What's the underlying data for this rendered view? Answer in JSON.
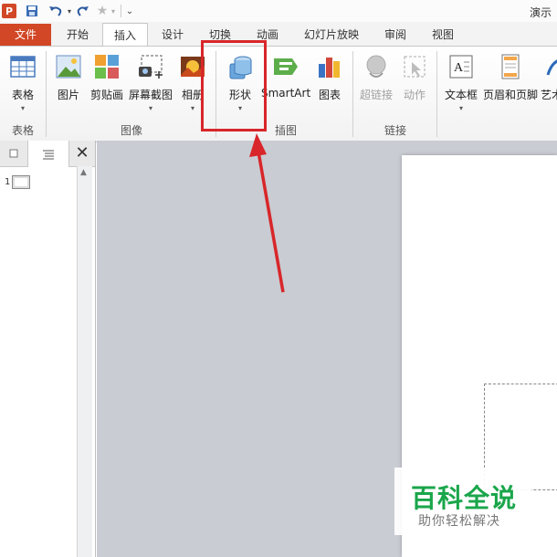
{
  "window": {
    "title": "演示"
  },
  "app_icon_letter": "P",
  "tabs": {
    "file": "文件",
    "items": [
      "开始",
      "插入",
      "设计",
      "切换",
      "动画",
      "幻灯片放映",
      "审阅",
      "视图"
    ]
  },
  "ribbon": {
    "buttons": {
      "table": "表格",
      "picture": "图片",
      "clipart": "剪贴画",
      "screenshot": "屏幕截图",
      "album": "相册",
      "shapes": "形状",
      "smartart": "SmartArt",
      "chart": "图表",
      "hyperlink": "超链接",
      "action": "动作",
      "textbox": "文本框",
      "header_footer": "页眉和页脚",
      "wordart": "艺术"
    },
    "groups": {
      "tables": "表格",
      "images": "图像",
      "illustrations": "插图",
      "links": "链接"
    }
  },
  "panel": {
    "slide_number": "1"
  },
  "watermark": {
    "title": "百科全说",
    "subtitle": "助你轻松解决"
  },
  "colors": {
    "accent": "#d24726",
    "highlight": "#d8262a",
    "watermark": "#1aa64b"
  }
}
